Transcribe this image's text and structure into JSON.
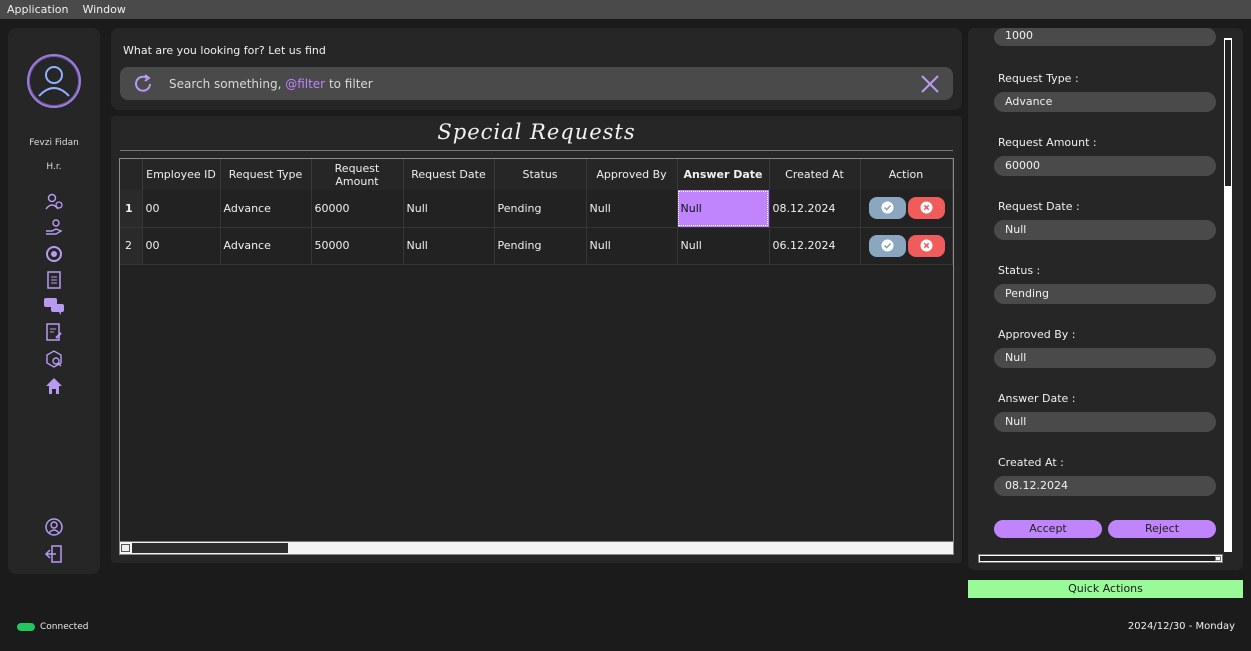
{
  "menu": {
    "application": "Application",
    "window": "Window"
  },
  "user": {
    "name": "Fevzi Fidan",
    "role": "H.r."
  },
  "search": {
    "hint": "What are you looking for? Let us find",
    "placeholder_prefix": "Search something, ",
    "placeholder_filter": "@filter",
    "placeholder_suffix": " to filter"
  },
  "page": {
    "title": "Special Requests"
  },
  "table": {
    "headers": [
      "Employee ID",
      "Request Type",
      "Request Amount",
      "Request Date",
      "Status",
      "Approved By",
      "Answer Date",
      "Created At",
      "Action"
    ],
    "rows": [
      {
        "num": "1",
        "employee_id": "00",
        "request_type": "Advance",
        "request_amount": "60000",
        "request_date": "Null",
        "status": "Pending",
        "approved_by": "Null",
        "answer_date": "Null",
        "created_at": "08.12.2024"
      },
      {
        "num": "2",
        "employee_id": "00",
        "request_type": "Advance",
        "request_amount": "50000",
        "request_date": "Null",
        "status": "Pending",
        "approved_by": "Null",
        "answer_date": "Null",
        "created_at": "06.12.2024"
      }
    ]
  },
  "detail": {
    "top_value": "1000",
    "fields": [
      {
        "label": "Request Type :",
        "value": "Advance"
      },
      {
        "label": "Request Amount :",
        "value": "60000"
      },
      {
        "label": "Request Date :",
        "value": "Null"
      },
      {
        "label": "Status :",
        "value": "Pending"
      },
      {
        "label": "Approved By :",
        "value": "Null"
      },
      {
        "label": "Answer Date :",
        "value": "Null"
      },
      {
        "label": "Created At :",
        "value": "08.12.2024"
      }
    ],
    "accept_label": "Accept",
    "reject_label": "Reject"
  },
  "quick_actions": "Quick Actions",
  "status": {
    "connection": "Connected",
    "datetime": "2024/12/30 - Monday"
  },
  "colors": {
    "accent": "#c084fc",
    "ok": "#8aa7bf",
    "danger": "#f05c5c",
    "quick": "#98fb98",
    "connected": "#22c55e"
  },
  "icons": [
    "user-circle-icon",
    "users-icon",
    "hand-coin-icon",
    "refresh-cog-icon",
    "document-list-icon",
    "chat-bubbles-icon",
    "document-edit-icon",
    "box-search-icon",
    "home-icon",
    "profile-icon",
    "logout-icon",
    "refresh-icon",
    "close-icon",
    "check-icon",
    "x-icon"
  ]
}
